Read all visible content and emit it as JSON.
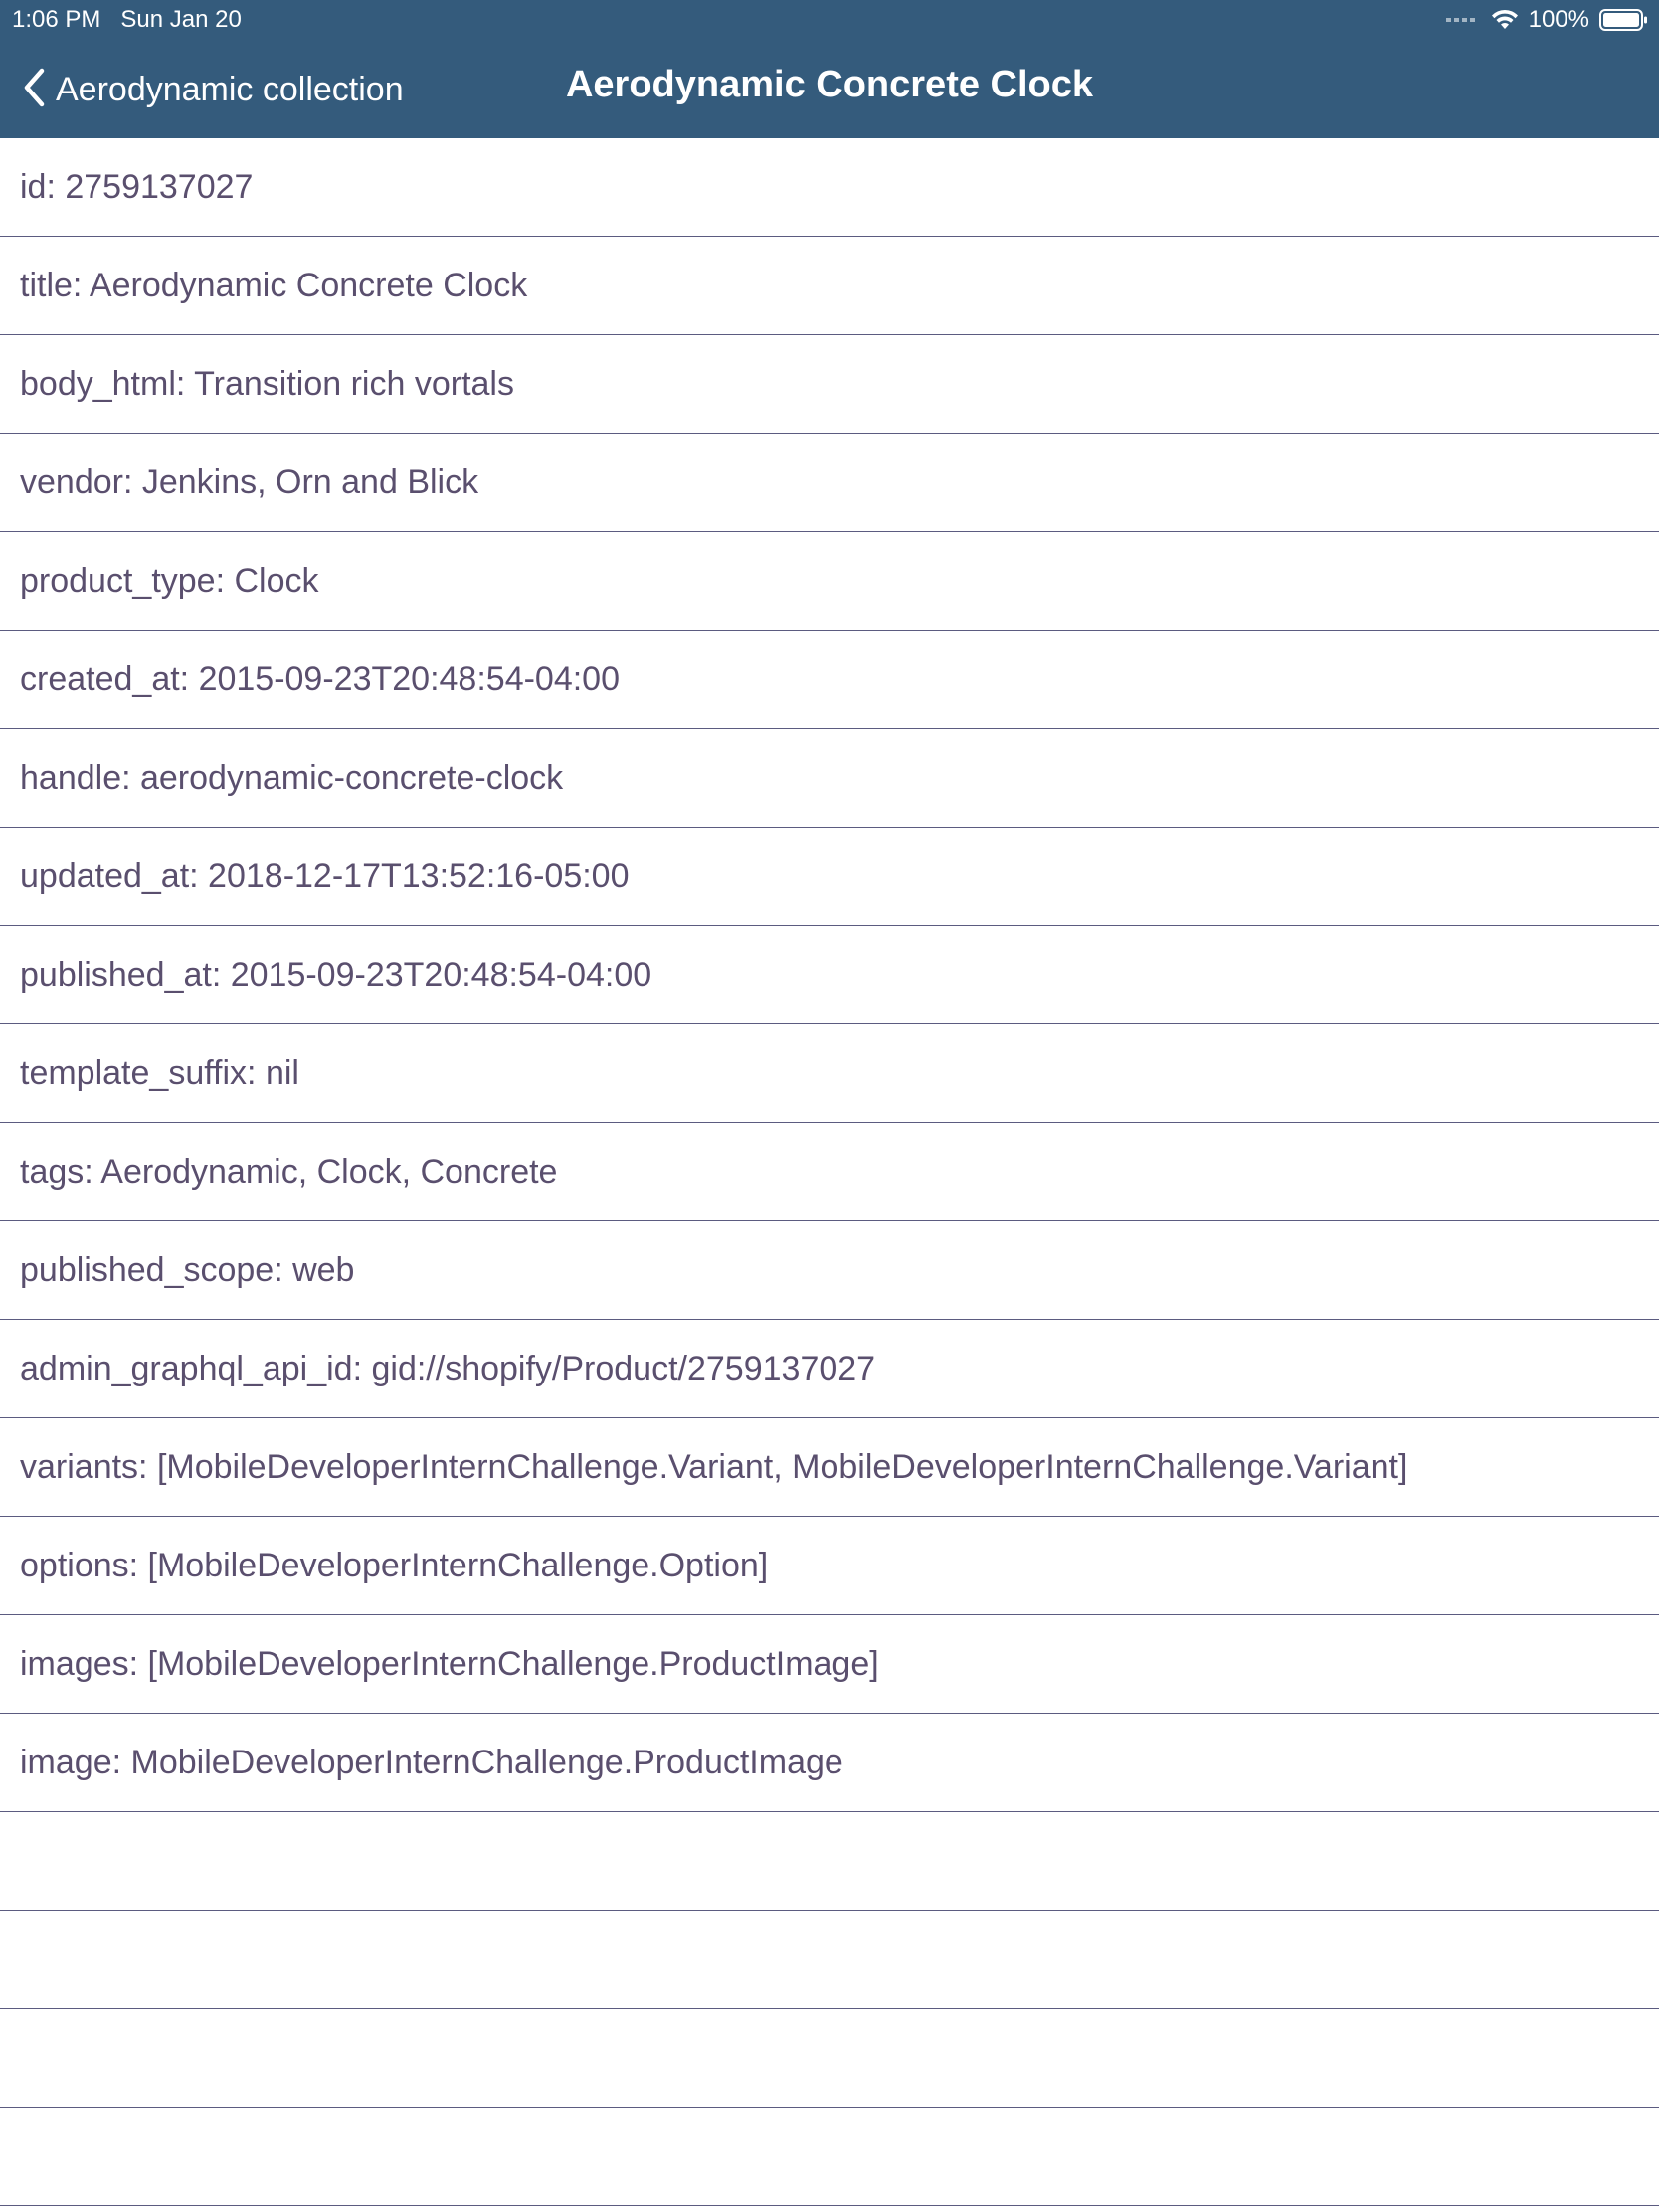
{
  "status_bar": {
    "time": "1:06 PM",
    "date": "Sun Jan 20",
    "battery": "100%"
  },
  "nav": {
    "back_label": "Aerodynamic collection",
    "title": "Aerodynamic Concrete Clock"
  },
  "rows": [
    "id: 2759137027",
    "title: Aerodynamic Concrete Clock",
    "body_html: Transition rich vortals",
    "vendor: Jenkins, Orn and Blick",
    "product_type: Clock",
    "created_at: 2015-09-23T20:48:54-04:00",
    "handle: aerodynamic-concrete-clock",
    "updated_at: 2018-12-17T13:52:16-05:00",
    "published_at: 2015-09-23T20:48:54-04:00",
    "template_suffix: nil",
    "tags: Aerodynamic, Clock, Concrete",
    "published_scope: web",
    "admin_graphql_api_id: gid://shopify/Product/2759137027",
    "variants: [MobileDeveloperInternChallenge.Variant, MobileDeveloperInternChallenge.Variant]",
    "options: [MobileDeveloperInternChallenge.Option]",
    "images: [MobileDeveloperInternChallenge.ProductImage]",
    "image: MobileDeveloperInternChallenge.ProductImage"
  ],
  "colors": {
    "nav_background": "#345b7c",
    "row_text": "#5a4f6e",
    "separator": "#5b5b80"
  }
}
